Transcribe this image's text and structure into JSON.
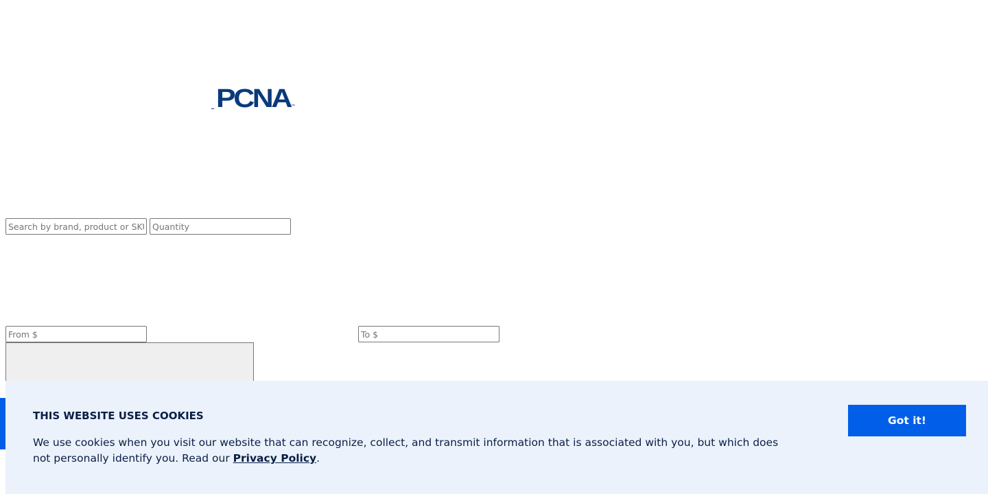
{
  "header": {
    "logo_text": "PCNA",
    "logo_mark": "™",
    "brand_color": "#0b3a7c"
  },
  "search": {
    "query_placeholder": "Search by brand, product or SKU",
    "query_value": "",
    "quantity_placeholder": "Quantity",
    "quantity_value": ""
  },
  "price_filter": {
    "from_placeholder": "From $",
    "from_value": "",
    "to_placeholder": "To $",
    "to_value": ""
  },
  "cookie_banner": {
    "title": "THIS WEBSITE USES COOKIES",
    "body_prefix": "We use cookies when you visit our website that can recognize, collect, and transmit information that is associated with you, but which does not personally identify you. Read our ",
    "privacy_link_label": "Privacy Policy",
    "body_suffix": ".",
    "accept_label": "Got it!",
    "background_color": "#ebf2fb",
    "accent_color": "#005ee8",
    "text_color": "#0a1e46"
  }
}
